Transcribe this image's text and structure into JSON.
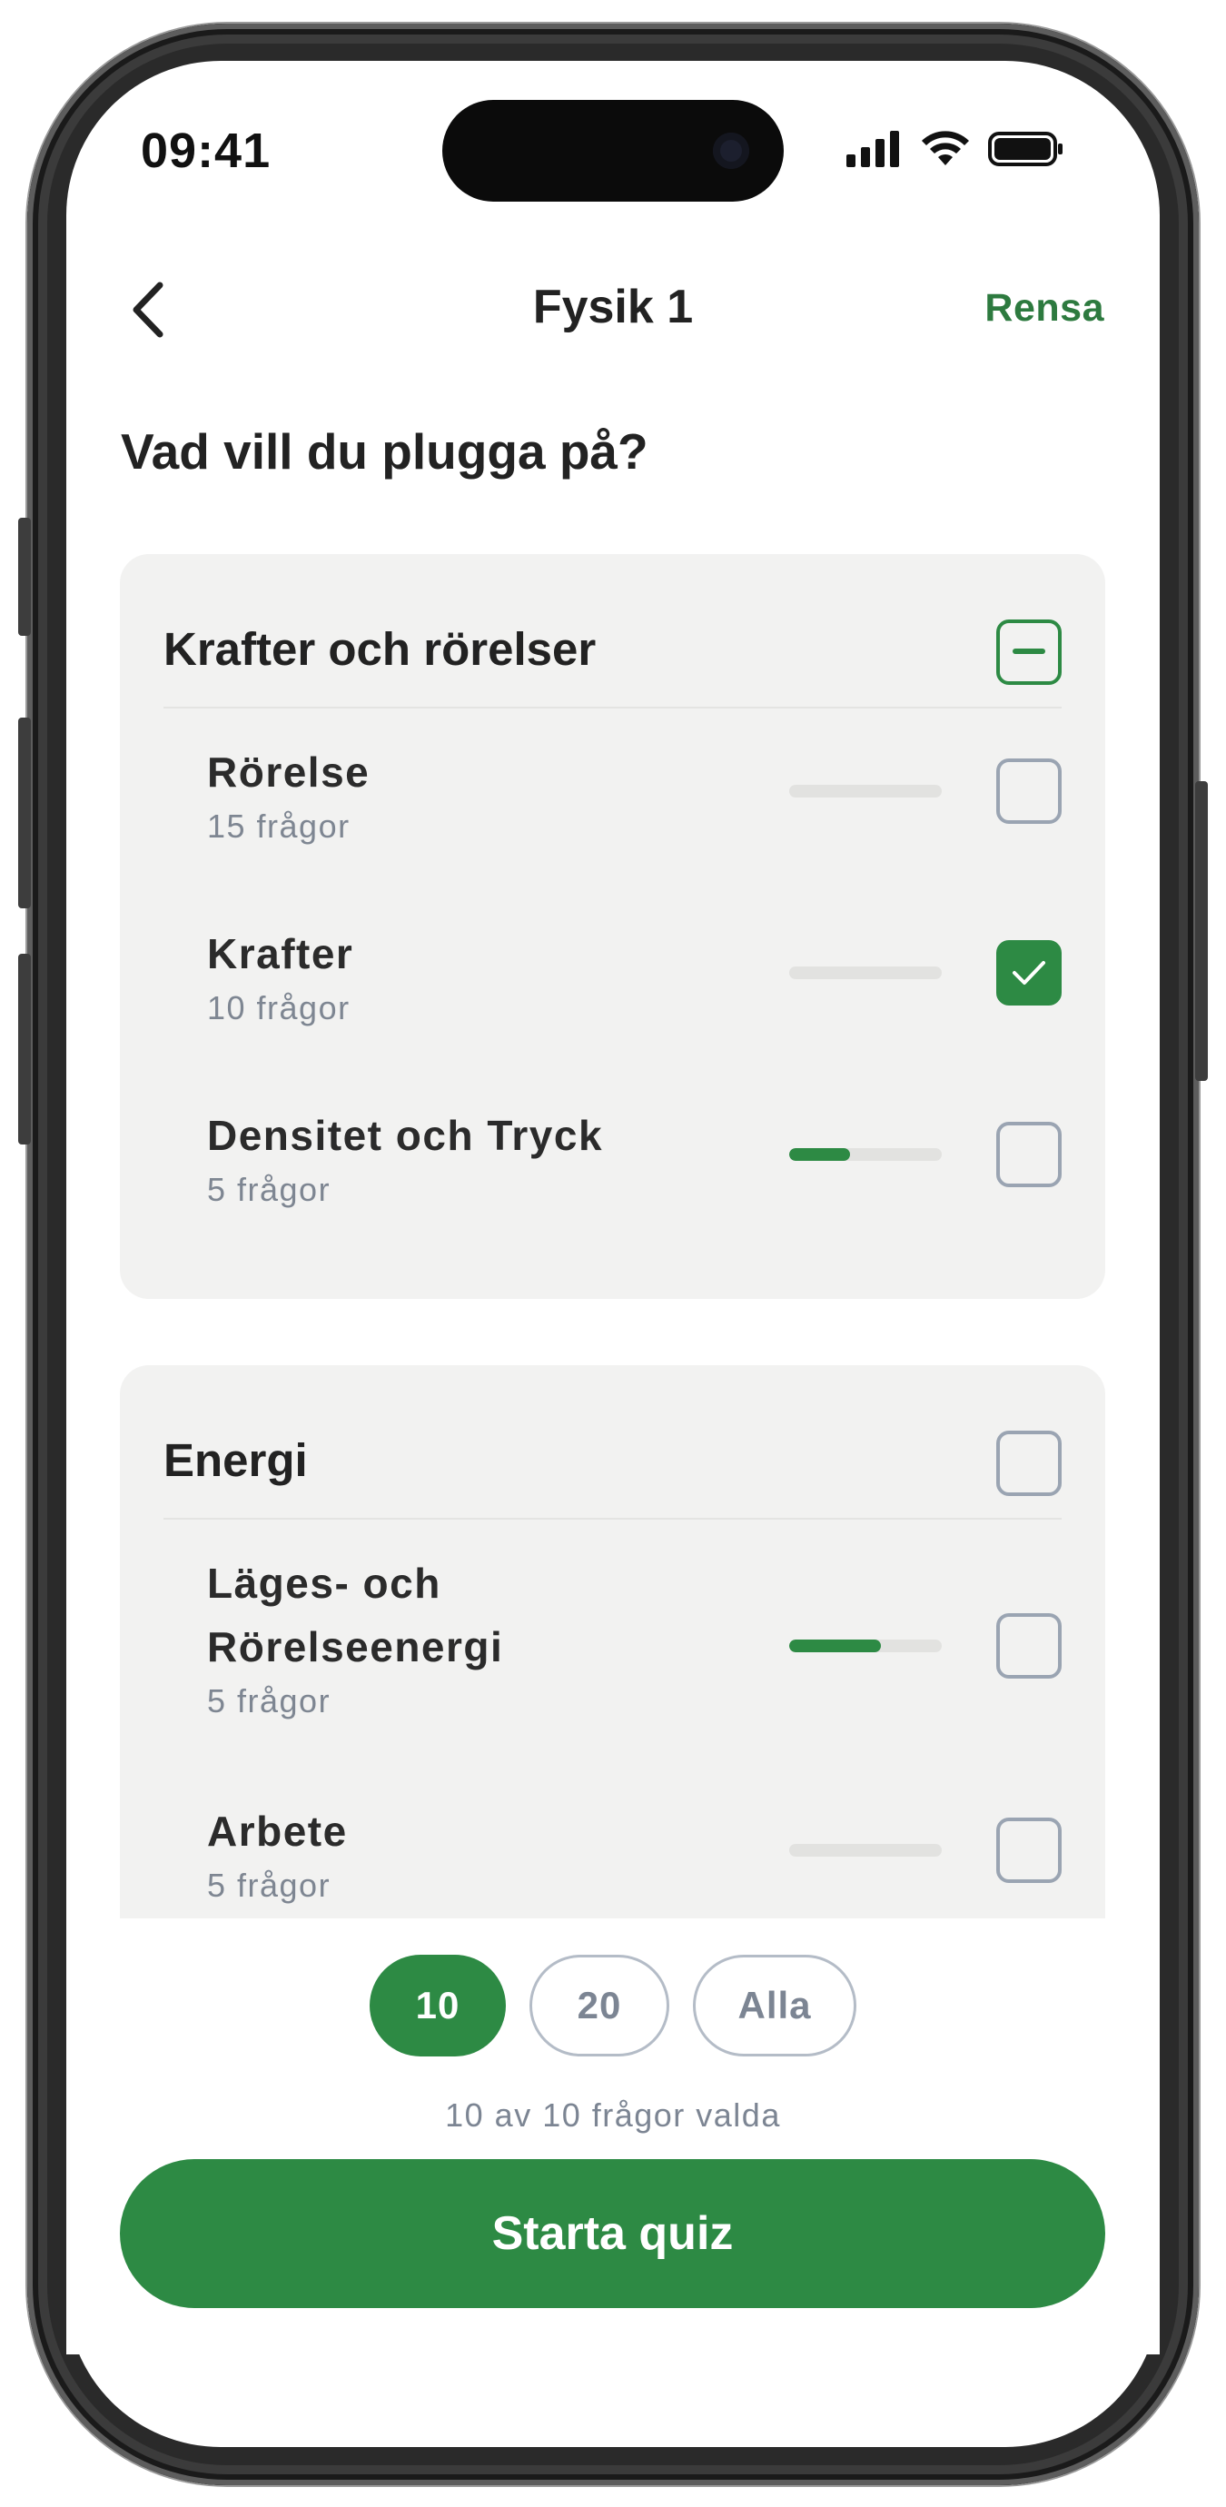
{
  "status_bar": {
    "time": "09:41"
  },
  "nav": {
    "title": "Fysik 1",
    "action": "Rensa"
  },
  "heading": "Vad vill du plugga på?",
  "groups": [
    {
      "title": "Krafter och rörelser",
      "state": "partial",
      "topics": [
        {
          "title": "Rörelse",
          "subtitle": "15 frågor",
          "progress": 0,
          "checked": false
        },
        {
          "title": "Krafter",
          "subtitle": "10 frågor",
          "progress": 0,
          "checked": true
        },
        {
          "title": "Densitet och Tryck",
          "subtitle": "5 frågor",
          "progress": 0.4,
          "checked": false
        }
      ]
    },
    {
      "title": "Energi",
      "state": "unchecked",
      "topics": [
        {
          "title_line1": "Läges- och",
          "title_line2": "Rörelseenergi",
          "subtitle": "5 frågor",
          "progress": 0.6,
          "checked": false
        },
        {
          "title": "Arbete",
          "subtitle": "5 frågor",
          "progress": 0,
          "checked": false
        }
      ]
    }
  ],
  "question_count": {
    "options": [
      "10",
      "20",
      "Alla"
    ],
    "selected": "10",
    "summary": "10 av 10 frågor valda"
  },
  "start_button": "Starta quiz",
  "colors": {
    "accent": "#2d8a44",
    "card_bg": "#f2f2f1",
    "muted_text": "#7c8593"
  }
}
